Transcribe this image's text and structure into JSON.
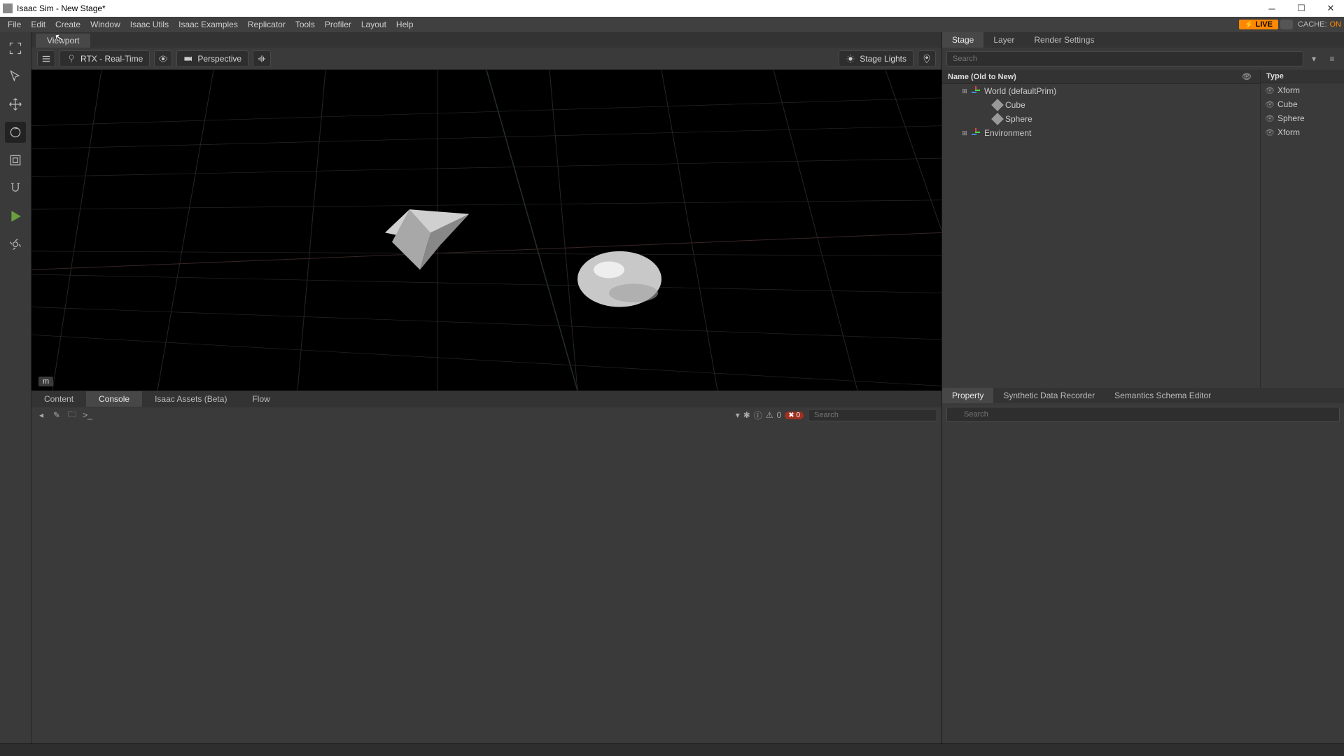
{
  "titlebar": {
    "title": "Isaac Sim  - New Stage*"
  },
  "menubar": {
    "items": [
      "File",
      "Edit",
      "Create",
      "Window",
      "Isaac Utils",
      "Isaac Examples",
      "Replicator",
      "Tools",
      "Profiler",
      "Layout",
      "Help"
    ],
    "live": "LIVE",
    "cache_label": "CACHE:",
    "cache_value": "ON"
  },
  "viewport": {
    "tab": "Viewport",
    "renderer": "RTX - Real-Time",
    "camera": "Perspective",
    "lights": "Stage Lights",
    "unit": "m"
  },
  "stage_panel": {
    "tabs": [
      "Stage",
      "Layer",
      "Render Settings"
    ],
    "search_placeholder": "Search",
    "header_name": "Name (Old to New)",
    "header_type": "Type",
    "tree": [
      {
        "indent": 1,
        "exp": "⊞",
        "icon": "axis",
        "label": "World (defaultPrim)",
        "type": "Xform"
      },
      {
        "indent": 2,
        "exp": "",
        "icon": "mesh",
        "label": "Cube",
        "type": "Cube"
      },
      {
        "indent": 2,
        "exp": "",
        "icon": "mesh",
        "label": "Sphere",
        "type": "Sphere"
      },
      {
        "indent": 1,
        "exp": "⊞",
        "icon": "axis",
        "label": "Environment",
        "type": "Xform"
      }
    ]
  },
  "property_panel": {
    "tabs": [
      "Property",
      "Synthetic Data Recorder",
      "Semantics Schema Editor"
    ],
    "search_placeholder": "Search"
  },
  "bottom_panel": {
    "tabs": [
      "Content",
      "Console",
      "Isaac Assets (Beta)",
      "Flow"
    ],
    "active": 1,
    "error_count": "0",
    "warn_count": "0",
    "search_placeholder": "Search"
  }
}
